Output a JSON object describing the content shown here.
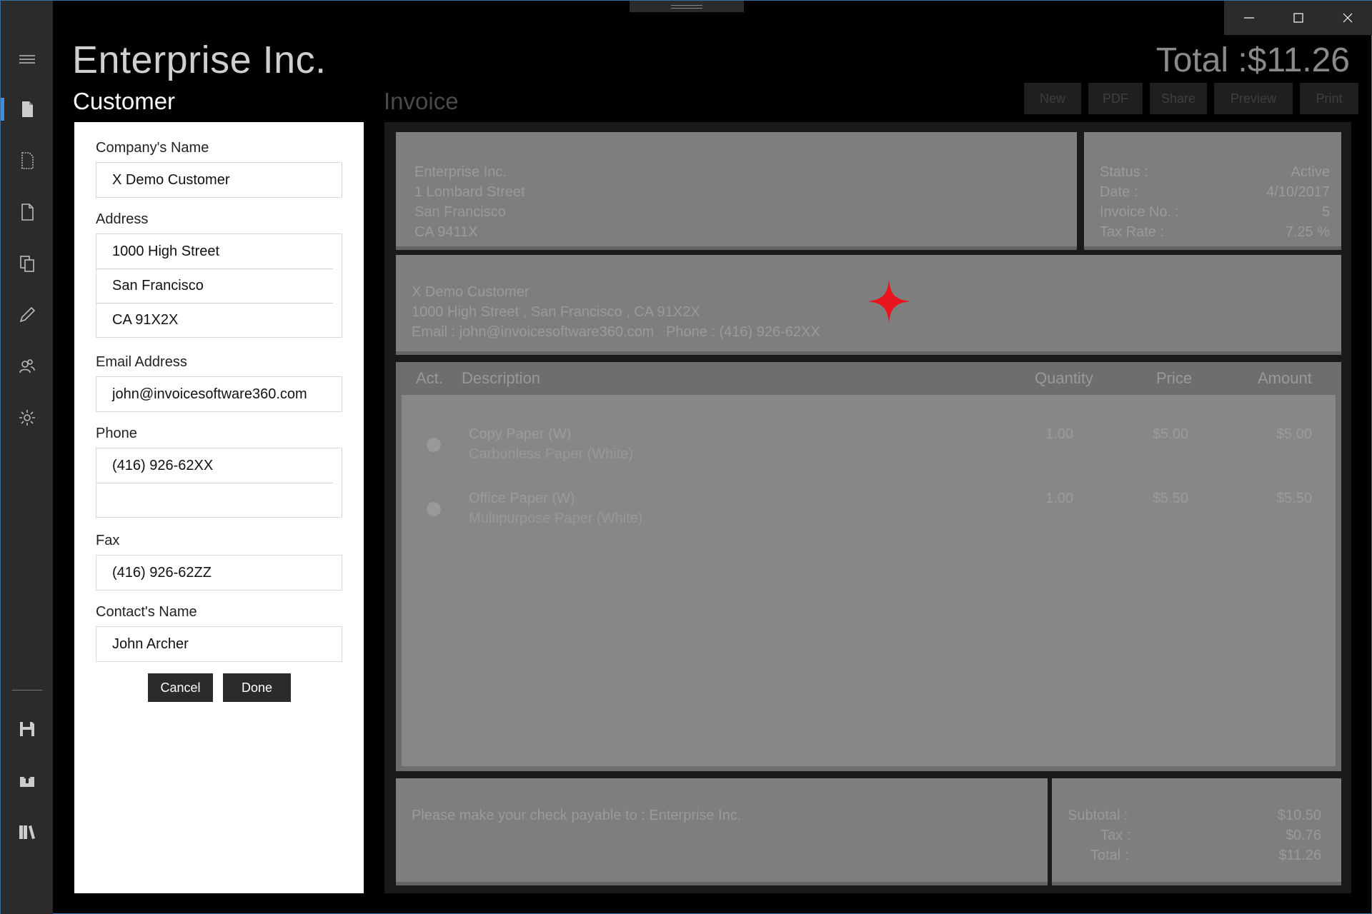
{
  "app": {
    "title": "Enterprise Inc.",
    "total_display": "Total :$11.26"
  },
  "headings": {
    "customer": "Customer",
    "invoice": "Invoice"
  },
  "toolbar": {
    "new": "New",
    "pdf": "PDF",
    "share": "Share",
    "preview": "Preview",
    "print": "Print"
  },
  "customer_form": {
    "company_label": "Company's Name",
    "company_value": "X Demo Customer",
    "address_label": "Address",
    "address_lines": [
      "1000 High Street",
      "San Francisco",
      "CA 91X2X"
    ],
    "email_label": "Email Address",
    "email_value": "john@invoicesoftware360.com",
    "phone_label": "Phone",
    "phone_lines": [
      "(416) 926-62XX",
      ""
    ],
    "fax_label": "Fax",
    "fax_value": "(416) 926-62ZZ",
    "contact_label": "Contact's Name",
    "contact_value": "John Archer",
    "cancel_label": "Cancel",
    "done_label": "Done"
  },
  "invoice": {
    "from": [
      "Enterprise Inc.",
      "1 Lombard Street",
      "San Francisco",
      "CA 9411X"
    ],
    "meta": [
      {
        "label": "Status :",
        "value": "Active"
      },
      {
        "label": "Date :",
        "value": "4/10/2017"
      },
      {
        "label": "Invoice No. :",
        "value": "5"
      },
      {
        "label": "Tax Rate :",
        "value": "7.25 %"
      }
    ],
    "to": {
      "name": "X Demo Customer",
      "address": "1000 High Street , San Francisco , CA 91X2X",
      "contact": "Email : john@invoicesoftware360.com   Phone : (416) 926-62XX"
    },
    "columns": {
      "act": "Act.",
      "description": "Description",
      "quantity": "Quantity",
      "price": "Price",
      "amount": "Amount"
    },
    "items": [
      {
        "name": "Copy Paper (W)",
        "sub": "Carbonless Paper (White)",
        "qty": "1.00",
        "price": "$5.00",
        "amount": "$5.00"
      },
      {
        "name": "Office Paper (W)",
        "sub": "Multipurpose Paper (White)",
        "qty": "1.00",
        "price": "$5.50",
        "amount": "$5.50"
      }
    ],
    "note": "Please make your check payable to : Enterprise Inc.",
    "totals": [
      {
        "label": "Subtotal :",
        "value": "$10.50"
      },
      {
        "label": "Tax :",
        "value": "$0.76"
      },
      {
        "label": "Total :",
        "value": "$11.26"
      }
    ]
  },
  "icons": {
    "rail_top": [
      "hamburger-menu-icon",
      "invoice-document-icon",
      "quote-document-icon",
      "blank-document-icon",
      "copy-documents-icon",
      "pencil-edit-icon",
      "people-icon",
      "gear-icon"
    ],
    "rail_bottom": [
      "save-floppy-icon",
      "upload-cloud-icon",
      "library-books-icon"
    ]
  },
  "colors": {
    "rail": "#2b2b2b",
    "accent": "#3a8ee6",
    "sparkle": "#e8141e"
  }
}
